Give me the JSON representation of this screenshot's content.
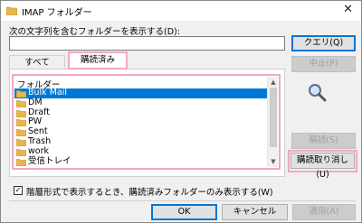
{
  "window": {
    "title": "IMAP フォルダー",
    "close_glyph": "✕"
  },
  "search": {
    "label": "次の文字列を含むフォルダーを表示する(D):",
    "value": ""
  },
  "tabs": [
    {
      "label": "すべて"
    },
    {
      "label": "購読済み"
    }
  ],
  "folder_list": {
    "header": "フォルダー",
    "items": [
      {
        "label": "Bulk Mail",
        "selected": true
      },
      {
        "label": "DM"
      },
      {
        "label": "Draft"
      },
      {
        "label": "PW"
      },
      {
        "label": "Sent"
      },
      {
        "label": "Trash"
      },
      {
        "label": "work"
      },
      {
        "label": "受信トレイ"
      }
    ]
  },
  "buttons": {
    "query": "クエリ(Q)",
    "stop": "中止(P)",
    "subscribe": "購読(S)",
    "unsubscribe": "購読取り消し(U)",
    "ok": "OK",
    "cancel": "キャンセル",
    "apply": "適用(A)"
  },
  "options": {
    "hierarchy_label": "階層形式で表示するとき、購読済みフォルダーのみ表示する(W)",
    "hierarchy_checked": true
  },
  "colors": {
    "selection": "#0078d7",
    "highlight_frame": "#f0a8c4"
  }
}
